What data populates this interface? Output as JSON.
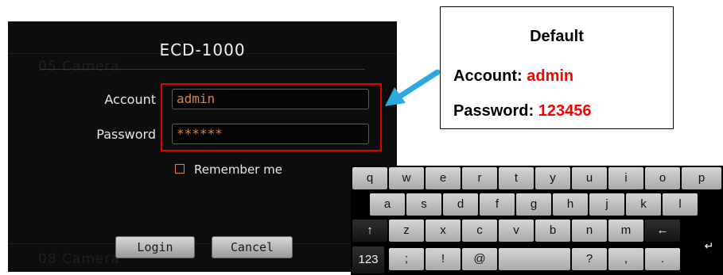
{
  "dialog": {
    "title": "ECD-1000",
    "background_labels": [
      "05 Camera",
      "08 Camera"
    ],
    "account_label": "Account",
    "account_value": "admin",
    "password_label": "Password",
    "password_value": "******",
    "remember_label": "Remember me",
    "login_label": "Login",
    "cancel_label": "Cancel"
  },
  "callout": {
    "title": "Default",
    "account_prefix": "Account:",
    "account_value": "admin",
    "password_prefix": "Password:",
    "password_value": "123456"
  },
  "keyboard": {
    "rows": [
      [
        "q",
        "w",
        "e",
        "r",
        "t",
        "y",
        "u",
        "i",
        "o",
        "p"
      ],
      [
        "a",
        "s",
        "d",
        "f",
        "g",
        "h",
        "j",
        "k",
        "l"
      ],
      [
        "↑",
        "z",
        "x",
        "c",
        "v",
        "b",
        "n",
        "m",
        "←",
        "↵"
      ],
      [
        "123",
        ";",
        "!",
        "@",
        "",
        "?",
        ",",
        "."
      ]
    ]
  },
  "colors": {
    "highlight_border": "#e00000",
    "field_text": "#e0823c",
    "callout_red": "#ff0000",
    "arrow": "#29abe2"
  }
}
